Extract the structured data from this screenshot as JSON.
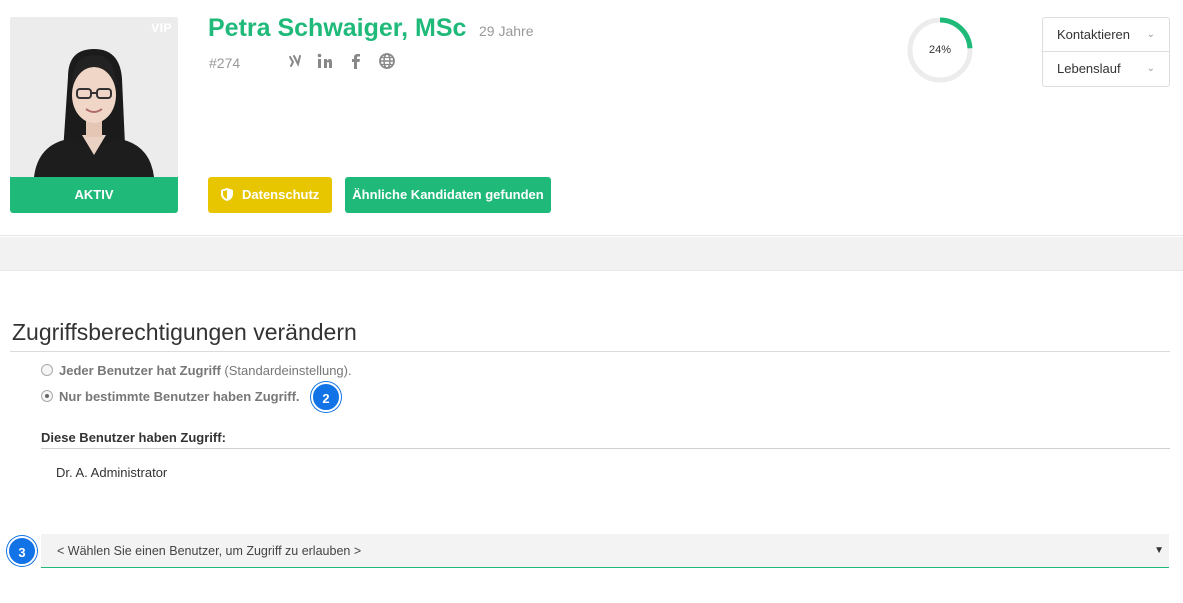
{
  "candidate": {
    "vip_label": "VIP",
    "status": "AKTIV",
    "name": "Petra Schwaiger, MSc",
    "age": "29 Jahre",
    "id": "#274",
    "progress_label": "24%",
    "progress_value": 0.24
  },
  "social_icons": [
    "xing-icon",
    "linkedin-icon",
    "facebook-icon",
    "globe-icon"
  ],
  "buttons": {
    "privacy": "Datenschutz",
    "similar": "Ähnliche Kandidaten gefunden",
    "contact": "Kontaktieren",
    "cv": "Lebenslauf"
  },
  "access": {
    "title": "Zugriffsberechtigungen verändern",
    "option_all_bold": "Jeder Benutzer hat Zugriff",
    "option_all_rest": " (Standardeinstellung).",
    "option_specific": "Nur bestimmte Benutzer haben Zugriff.",
    "users_label": "Diese Benutzer haben Zugriff:",
    "users": [
      "Dr. A. Administrator"
    ],
    "select_placeholder": "< Wählen Sie einen Benutzer, um Zugriff zu erlauben >"
  },
  "badges": {
    "step2": "2",
    "step3": "3"
  },
  "colors": {
    "accent": "#1fba7a",
    "privacy": "#e7c600",
    "badge": "#1273e6"
  }
}
